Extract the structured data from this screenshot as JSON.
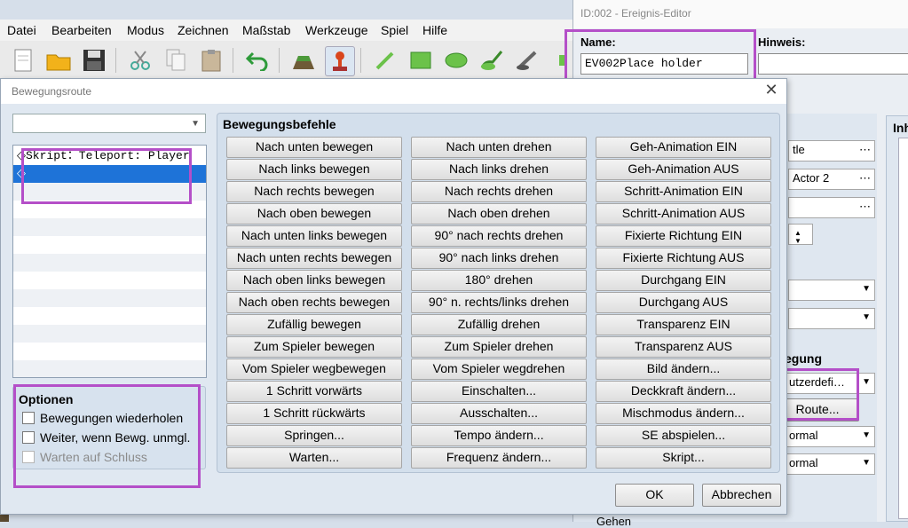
{
  "menu": [
    "Datei",
    "Bearbeiten",
    "Modus",
    "Zeichnen",
    "Maßstab",
    "Werkzeuge",
    "Spiel",
    "Hilfe"
  ],
  "editor": {
    "title": "ID:002 - Ereignis-Editor",
    "name_label": "Name:",
    "name_value": "EV002Place holder",
    "note_label": "Hinweis:",
    "right_label": "Inh",
    "fields": [
      "tle",
      "Actor 2"
    ],
    "movement_label": "egung",
    "type_value": "utzerdefi…",
    "route_button": "Route...",
    "speed_value": "ormal",
    "freq_value": "ormal",
    "checkbox_label": "Gehen"
  },
  "dialog": {
    "title": "Bewegungsroute",
    "close": "✕",
    "route_items": [
      "◇Skript：Teleport: Player",
      "◇"
    ],
    "options_title": "Optionen",
    "options": [
      {
        "label": "Bewegungen wiederholen",
        "checked": false,
        "enabled": true
      },
      {
        "label": "Weiter, wenn Bewg. unmgl.",
        "checked": false,
        "enabled": true
      },
      {
        "label": "Warten auf Schluss",
        "checked": false,
        "enabled": false
      }
    ],
    "commands_title": "Bewegungsbefehle",
    "commands": [
      [
        "Nach unten bewegen",
        "Nach unten drehen",
        "Geh-Animation EIN"
      ],
      [
        "Nach links bewegen",
        "Nach links drehen",
        "Geh-Animation AUS"
      ],
      [
        "Nach rechts bewegen",
        "Nach rechts drehen",
        "Schritt-Animation EIN"
      ],
      [
        "Nach oben bewegen",
        "Nach oben drehen",
        "Schritt-Animation AUS"
      ],
      [
        "Nach unten links bewegen",
        "90° nach rechts drehen",
        "Fixierte Richtung EIN"
      ],
      [
        "Nach unten rechts bewegen",
        "90° nach links drehen",
        "Fixierte Richtung AUS"
      ],
      [
        "Nach oben links bewegen",
        "180° drehen",
        "Durchgang EIN"
      ],
      [
        "Nach oben rechts bewegen",
        "90° n. rechts/links drehen",
        "Durchgang AUS"
      ],
      [
        "Zufällig bewegen",
        "Zufällig drehen",
        "Transparenz EIN"
      ],
      [
        "Zum Spieler bewegen",
        "Zum Spieler drehen",
        "Transparenz AUS"
      ],
      [
        "Vom Spieler wegbewegen",
        "Vom Spieler wegdrehen",
        "Bild ändern..."
      ],
      [
        "1 Schritt vorwärts",
        "Einschalten...",
        "Deckkraft ändern..."
      ],
      [
        "1 Schritt rückwärts",
        "Ausschalten...",
        "Mischmodus ändern..."
      ],
      [
        "Springen...",
        "Tempo ändern...",
        "SE abspielen..."
      ],
      [
        "Warten...",
        "Frequenz ändern...",
        "Skript..."
      ]
    ],
    "ok": "OK",
    "cancel": "Abbrechen"
  },
  "colors": {
    "highlight": "#b44fc8",
    "selection": "#1e73d8"
  }
}
